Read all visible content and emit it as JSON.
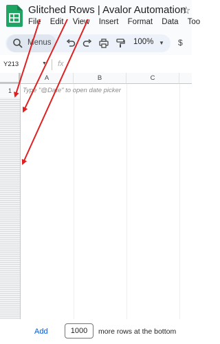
{
  "app": {
    "title": "Glitched Rows | Avalor Automation",
    "menu": [
      "File",
      "Edit",
      "View",
      "Insert",
      "Format",
      "Data",
      "Too"
    ]
  },
  "toolbar": {
    "search_placeholder": "Menus",
    "zoom": "100%",
    "currency": "$",
    "icons": [
      "undo-icon",
      "redo-icon",
      "print-icon",
      "paint-format-icon"
    ]
  },
  "formula_bar": {
    "name_box": "Y213",
    "fx": "fx"
  },
  "grid": {
    "columns": [
      "A",
      "B",
      "C"
    ],
    "rows": [
      "1"
    ],
    "cell_hint": "Type \"@Date\" to open date picker"
  },
  "footer": {
    "add_label": "Add",
    "rows_value": "1000",
    "text": "more rows at the bottom"
  },
  "colors": {
    "annotation_arrow": "#e02020",
    "sheets_green": "#1fa463",
    "link_blue": "#0b57d0"
  }
}
